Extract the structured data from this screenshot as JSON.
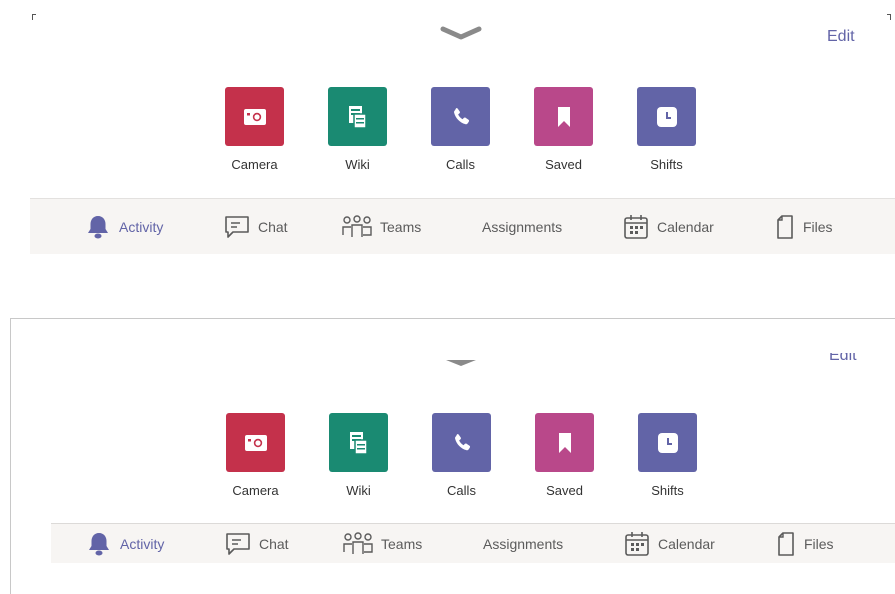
{
  "edit_label": "Edit",
  "apps": [
    {
      "label": "Camera",
      "icon": "camera-icon",
      "color": "#c4314b"
    },
    {
      "label": "Wiki",
      "icon": "wiki-icon",
      "color": "#1a8a72"
    },
    {
      "label": "Calls",
      "icon": "phone-icon",
      "color": "#6264a7"
    },
    {
      "label": "Saved",
      "icon": "bookmark-icon",
      "color": "#b9488a"
    },
    {
      "label": "Shifts",
      "icon": "clock-icon",
      "color": "#6264a7"
    }
  ],
  "tabs": [
    {
      "label": "Activity",
      "icon": "bell-icon",
      "active": true
    },
    {
      "label": "Chat",
      "icon": "chat-icon",
      "active": false
    },
    {
      "label": "Teams",
      "icon": "teams-icon",
      "active": false
    },
    {
      "label": "Assignments",
      "icon": "",
      "active": false
    },
    {
      "label": "Calendar",
      "icon": "calendar-icon",
      "active": false
    },
    {
      "label": "Files",
      "icon": "file-icon",
      "active": false
    }
  ],
  "colors": {
    "accent": "#6264a7",
    "tabbar_bg": "#f7f5f3"
  }
}
